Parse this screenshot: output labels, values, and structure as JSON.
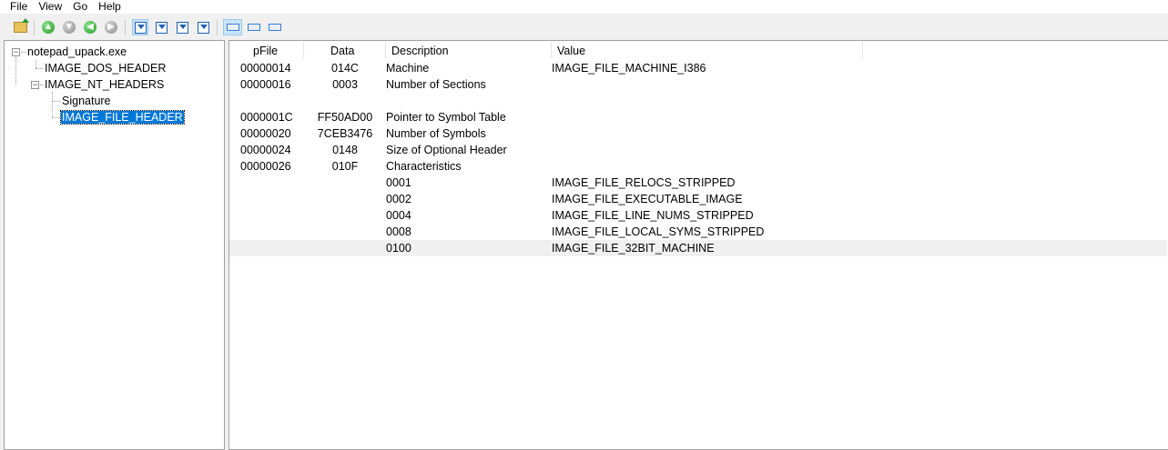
{
  "menu": [
    "File",
    "View",
    "Go",
    "Help"
  ],
  "toolbar": {
    "icons": [
      "open-icon",
      "back-icon",
      "forward-icon",
      "previous-icon",
      "next-icon",
      "view-hex-icon",
      "view-struct-icon",
      "export-icon",
      "save-icon",
      "view-list-icon",
      "view-detail-icon",
      "view-small-icon"
    ]
  },
  "tree": {
    "root": "notepad_upack.exe",
    "dos_header": "IMAGE_DOS_HEADER",
    "nt_headers": "IMAGE_NT_HEADERS",
    "signature": "Signature",
    "file_header": "IMAGE_FILE_HEADER"
  },
  "table": {
    "columns": [
      "pFile",
      "Data",
      "Description",
      "Value"
    ],
    "rows": [
      {
        "pfile": "00000014",
        "data": "014C",
        "desc": "Machine",
        "value": "IMAGE_FILE_MACHINE_I386"
      },
      {
        "pfile": "00000016",
        "data": "0003",
        "desc": "Number of Sections",
        "value": ""
      },
      {
        "pfile": "",
        "data": "",
        "desc": "",
        "value": ""
      },
      {
        "pfile": "0000001C",
        "data": "FF50AD00",
        "desc": "Pointer to Symbol Table",
        "value": ""
      },
      {
        "pfile": "00000020",
        "data": "7CEB3476",
        "desc": "Number of Symbols",
        "value": ""
      },
      {
        "pfile": "00000024",
        "data": "0148",
        "desc": "Size of Optional Header",
        "value": ""
      },
      {
        "pfile": "00000026",
        "data": "010F",
        "desc": "Characteristics",
        "value": ""
      },
      {
        "pfile": "",
        "data": "",
        "desc": "0001",
        "value": "IMAGE_FILE_RELOCS_STRIPPED"
      },
      {
        "pfile": "",
        "data": "",
        "desc": "0002",
        "value": "IMAGE_FILE_EXECUTABLE_IMAGE"
      },
      {
        "pfile": "",
        "data": "",
        "desc": "0004",
        "value": "IMAGE_FILE_LINE_NUMS_STRIPPED"
      },
      {
        "pfile": "",
        "data": "",
        "desc": "0008",
        "value": "IMAGE_FILE_LOCAL_SYMS_STRIPPED"
      },
      {
        "pfile": "",
        "data": "",
        "desc": "0100",
        "value": "IMAGE_FILE_32BIT_MACHINE"
      }
    ]
  }
}
